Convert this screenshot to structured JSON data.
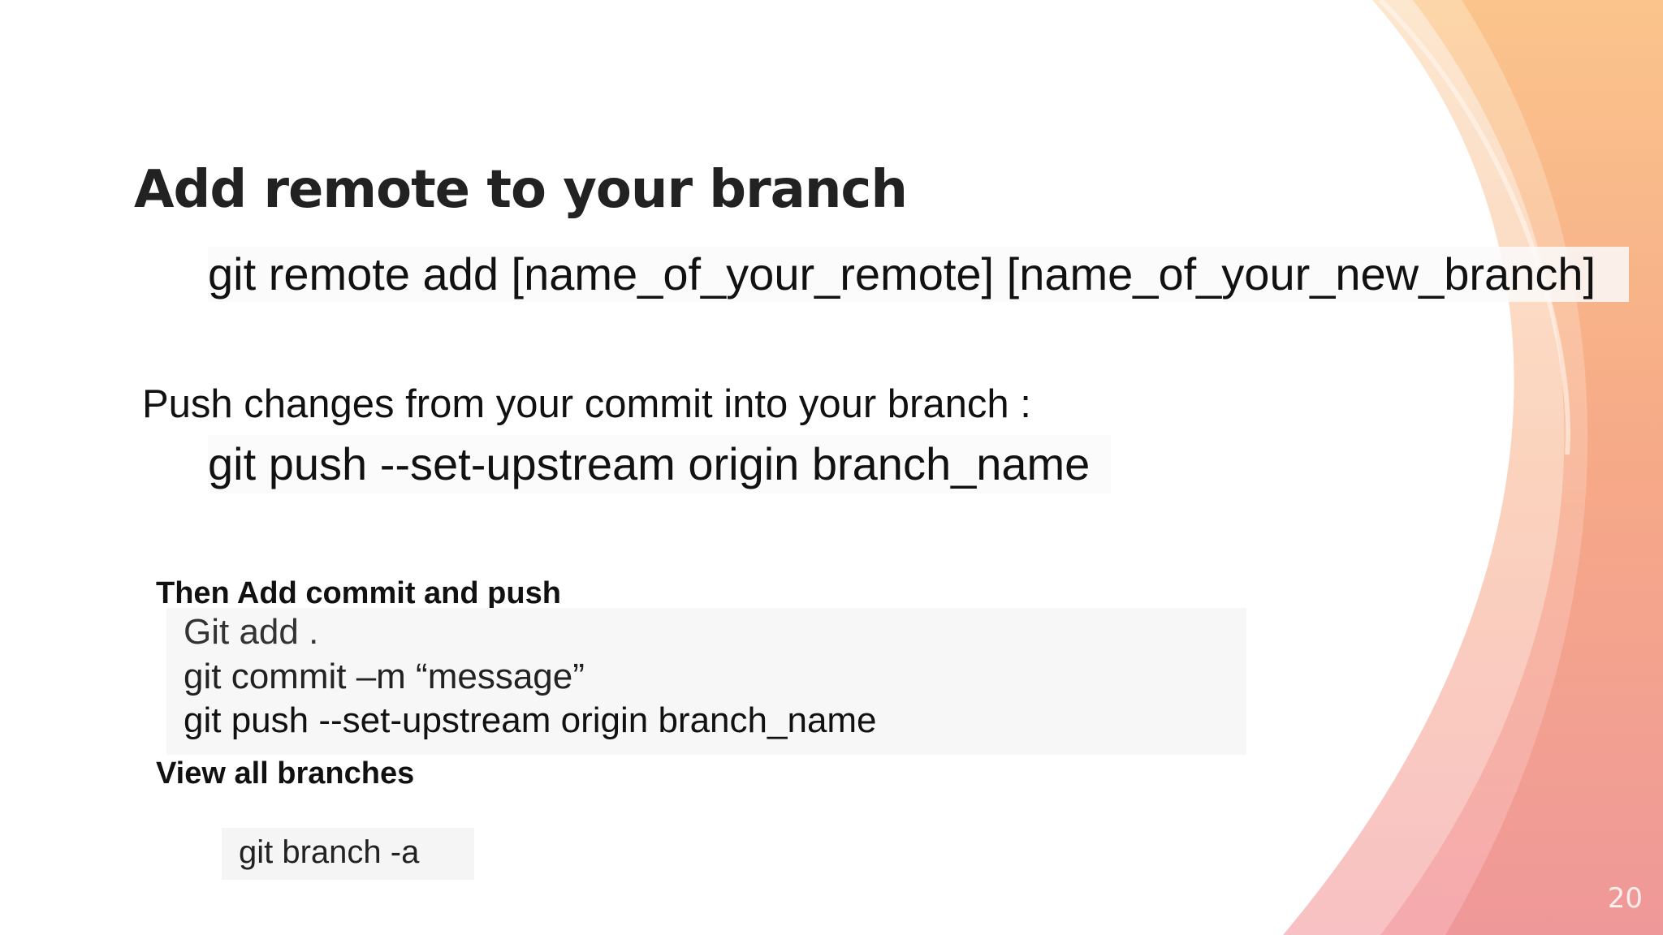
{
  "slide": {
    "title": "Add remote to your branch",
    "remote_command": "git remote add [name_of_your_remote] [name_of_your_new_branch]",
    "push_label": "Push changes from your commit into your branch :",
    "push_command": "git push --set-upstream origin branch_name",
    "commit_heading": "Then Add commit and push",
    "commit_block": [
      "Git add .",
      "git commit –m “message”",
      "git push --set-upstream origin branch_name"
    ],
    "branches_heading": "View all branches",
    "branch_command": "git branch -a",
    "page_number": "20"
  },
  "colors": {
    "accent_orange": "#f7b27a",
    "accent_peach": "#fbd3a8",
    "accent_pink": "#f19aa0",
    "code_background": "#f7f7f8",
    "text": "#111111"
  }
}
